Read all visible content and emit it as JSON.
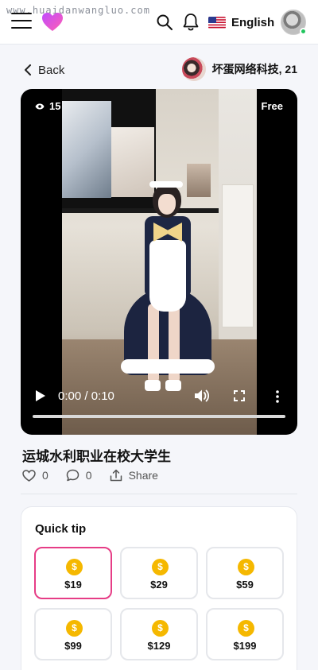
{
  "watermark": "www.huaidanwangluo.com",
  "header": {
    "language": "English",
    "icons": [
      "menu-icon",
      "heart-logo-icon",
      "search-icon",
      "bell-icon",
      "us-flag-icon",
      "avatar"
    ],
    "online_color": "#22c55e"
  },
  "nav": {
    "back_label": "Back",
    "creator_name": "坏蛋网络科技, 21"
  },
  "video": {
    "views": "15",
    "badge": "Free",
    "time": "0:00 / 0:10",
    "progress": 0
  },
  "post": {
    "title": "运城水利职业在校大学生",
    "likes": "0",
    "comments": "0",
    "share_label": "Share"
  },
  "quick_tip": {
    "title": "Quick tip",
    "accent_color": "#e63d86",
    "coin_color": "#f5b800",
    "selected_index": 0,
    "options": [
      {
        "coin": "$",
        "amount": "$19"
      },
      {
        "coin": "$",
        "amount": "$29"
      },
      {
        "coin": "$",
        "amount": "$59"
      },
      {
        "coin": "$",
        "amount": "$99"
      },
      {
        "coin": "$",
        "amount": "$129"
      },
      {
        "coin": "$",
        "amount": "$199"
      }
    ]
  }
}
